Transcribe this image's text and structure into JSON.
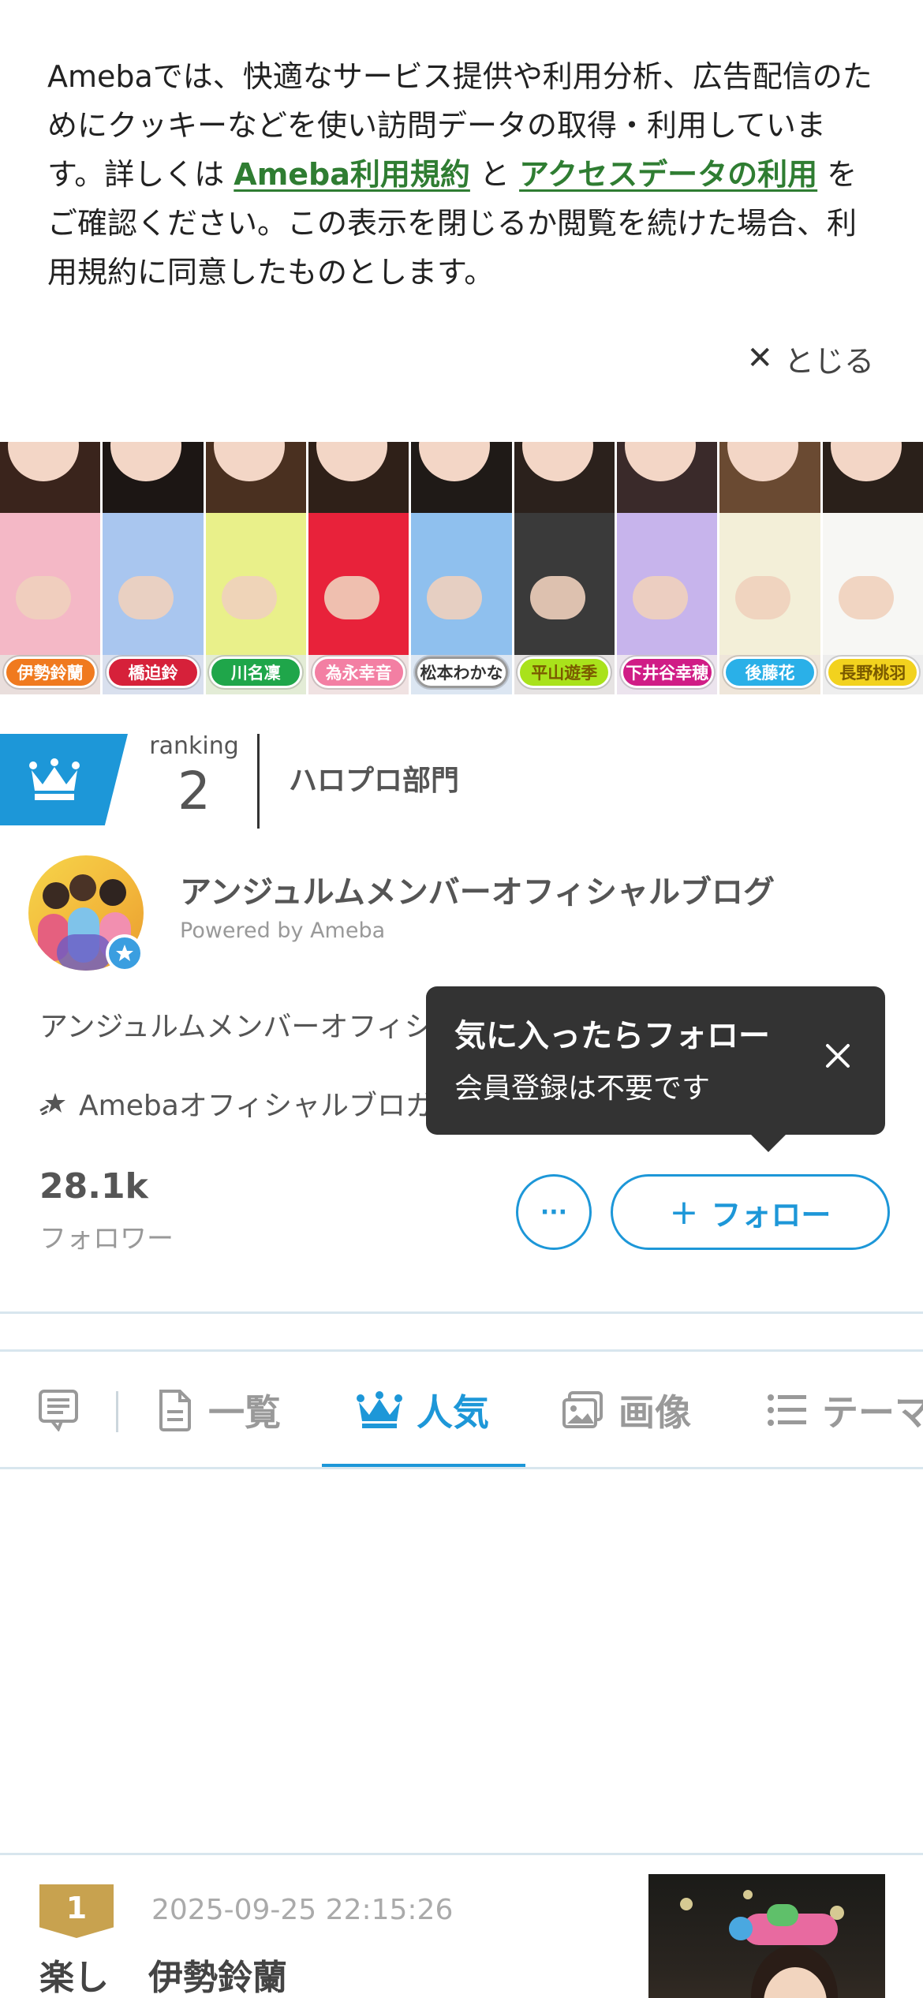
{
  "cookie_banner": {
    "text_before": "Amebaでは、快適なサービス提供や利用分析、広告配信のためにクッキーなどを使い訪問データの取得・利用しています。詳しくは ",
    "link_terms": "Ameba利用規約",
    "text_middle": " と ",
    "link_access": "アクセスデータの利用",
    "text_after": " をご確認ください。この表示を閉じるか閲覧を続けた場合、利用規約に同意したものとします。",
    "close_label": "とじる",
    "link_color": "#2f7d32"
  },
  "header_members": [
    {
      "name": "伊勢鈴蘭",
      "color": "#f07a1f"
    },
    {
      "name": "橋迫鈴",
      "color": "#d6213a"
    },
    {
      "name": "川名凜",
      "color": "#1fa64a"
    },
    {
      "name": "為永幸音",
      "color": "#f37fa3"
    },
    {
      "name": "松本わかな",
      "color": "#ffffff"
    },
    {
      "name": "平山遊季",
      "color": "#a9e21b"
    },
    {
      "name": "下井谷幸穂",
      "color": "#d01d86"
    },
    {
      "name": "後藤花",
      "color": "#2ab0e8"
    },
    {
      "name": "長野桃羽",
      "color": "#f2d21e"
    }
  ],
  "ranking": {
    "label": "ranking",
    "position": "2",
    "category": "ハロプロ部門",
    "badge_color": "#1d97d8"
  },
  "blog": {
    "title": "アンジュルムメンバーオフィシャルブログ",
    "powered_by": "Powered by Ameba",
    "description": "アンジュルムメンバーオフィシ",
    "official_label": "Amebaオフィシャルブロガ",
    "followers_count": "28.1k",
    "followers_label": "フォロワー",
    "more_label": "···",
    "follow_label": "フォロー"
  },
  "tooltip": {
    "title": "気に入ったらフォロー",
    "subtitle": "会員登録は不要です"
  },
  "tabs": [
    {
      "label": "",
      "icon": "comment-list-icon"
    },
    {
      "label": "一覧",
      "icon": "document-icon"
    },
    {
      "label": "人気",
      "icon": "crown-icon",
      "active": true
    },
    {
      "label": "画像",
      "icon": "image-icon"
    },
    {
      "label": "テーマ",
      "icon": "list-icon"
    }
  ],
  "entry": {
    "rank": "1",
    "date": "2025-09-25 22:15:26",
    "title_prefix": "楽し",
    "author": "伊勢鈴蘭",
    "rank_color": "#c8a24f"
  }
}
